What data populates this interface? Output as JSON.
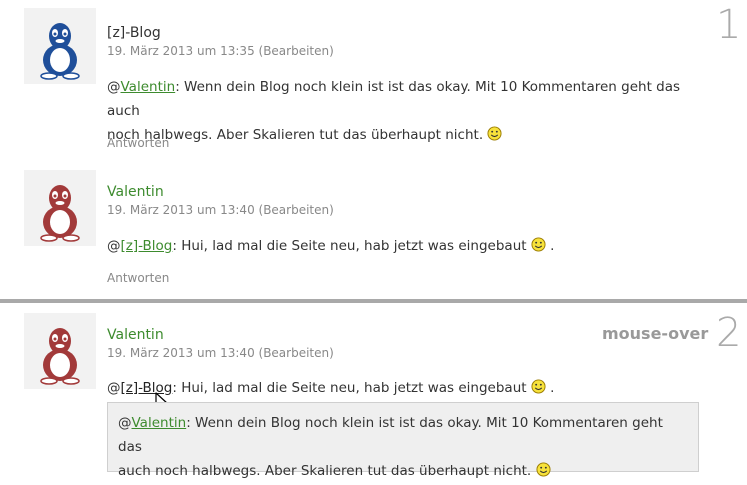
{
  "sections": [
    {
      "number": "1",
      "comments": [
        {
          "author": "[z]-Blog",
          "meta": "19. März 2013 um 13:35 (Bearbeiten)",
          "mention": "Valentin",
          "text_prefix": "@",
          "text_line1_rest": ": Wenn dein Blog noch klein ist ist das okay. Mit 10 Kommentaren geht das auch",
          "text_line2": "noch halbwegs. Aber Skalieren tut das überhaupt nicht.",
          "reply": "Antworten",
          "avatar_color": "#1f4f9a"
        },
        {
          "author": "Valentin",
          "meta": "19. März 2013 um 13:40 (Bearbeiten)",
          "text_prefix": "@",
          "mention": "[z]-Blog",
          "text_rest": ": Hui, lad mal die Seite neu, hab jetzt was eingebaut",
          "text_suffix": ".",
          "reply": "Antworten",
          "avatar_color": "#a23a3a"
        }
      ]
    },
    {
      "number": "2",
      "label": "mouse-over",
      "comment": {
        "author": "Valentin",
        "meta": "19. März 2013 um 13:40 (Bearbeiten)",
        "text_prefix": "@",
        "mention": "[z]-Blog",
        "text_rest": ": Hui, lad mal die Seite neu, hab jetzt was eingebaut",
        "text_suffix": ".",
        "avatar_color": "#a23a3a"
      },
      "tooltip": {
        "text_prefix": "@",
        "mention": "Valentin",
        "line1_rest": ": Wenn dein Blog noch klein ist ist das okay. Mit 10 Kommentaren geht das",
        "line2": "auch noch halbwegs. Aber Skalieren tut das überhaupt nicht."
      }
    }
  ],
  "colors": {
    "link": "#3d8b2e",
    "divider": "#a9a9a9",
    "tooltip_bg": "#efefef"
  }
}
